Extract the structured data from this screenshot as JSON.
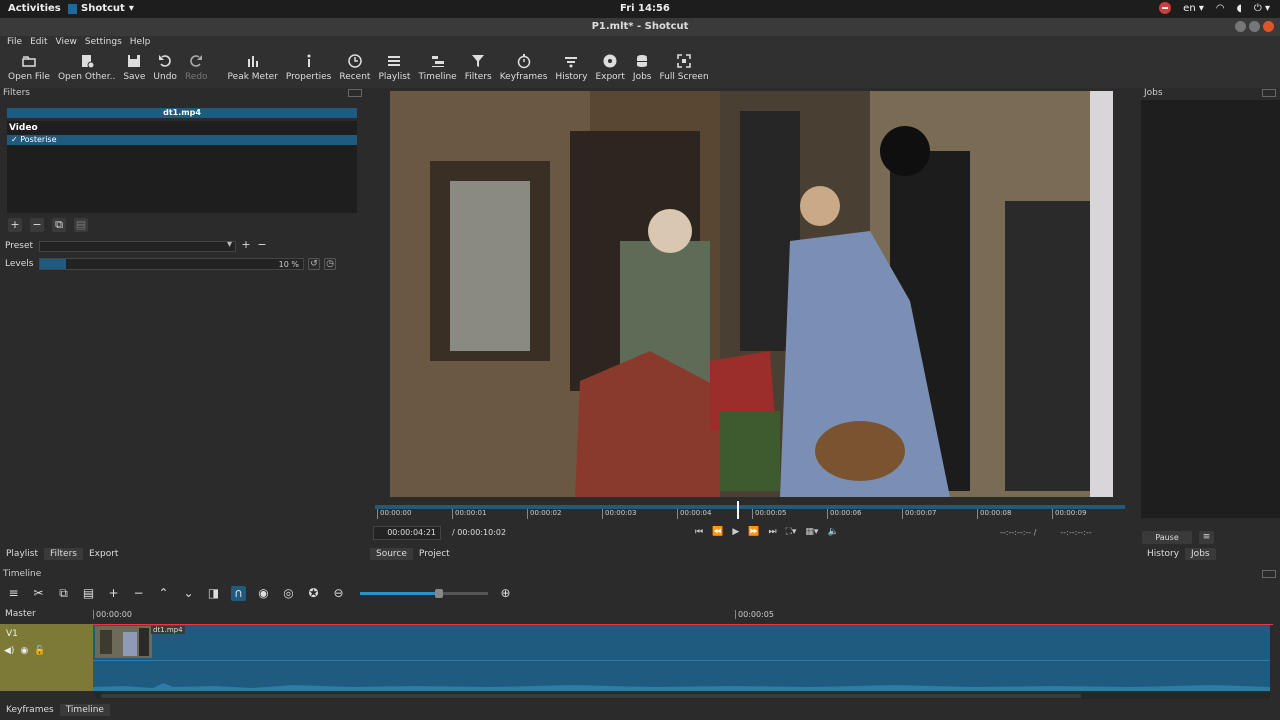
{
  "topbar": {
    "activities": "Activities",
    "app_name": "Shotcut",
    "clock": "Fri 14:56",
    "lang": "en"
  },
  "window": {
    "title": "P1.mlt* - Shotcut"
  },
  "menu": [
    "File",
    "Edit",
    "View",
    "Settings",
    "Help"
  ],
  "toolbar": [
    {
      "label": "Open File",
      "icon": "folder-open-icon"
    },
    {
      "label": "Open Other..",
      "icon": "open-other-icon"
    },
    {
      "label": "Save",
      "icon": "save-icon"
    },
    {
      "label": "Undo",
      "icon": "undo-icon"
    },
    {
      "label": "Redo",
      "icon": "redo-icon"
    },
    {
      "label": "Peak Meter",
      "icon": "peak-meter-icon"
    },
    {
      "label": "Properties",
      "icon": "info-icon"
    },
    {
      "label": "Recent",
      "icon": "clock-icon"
    },
    {
      "label": "Playlist",
      "icon": "list-icon"
    },
    {
      "label": "Timeline",
      "icon": "timeline-icon"
    },
    {
      "label": "Filters",
      "icon": "funnel-icon"
    },
    {
      "label": "Keyframes",
      "icon": "stopwatch-icon"
    },
    {
      "label": "History",
      "icon": "history-icon"
    },
    {
      "label": "Export",
      "icon": "disc-icon"
    },
    {
      "label": "Jobs",
      "icon": "database-icon"
    },
    {
      "label": "Full Screen",
      "icon": "fullscreen-icon"
    }
  ],
  "filters": {
    "panel_title": "Filters",
    "clip_name": "dt1.mp4",
    "section": "Video",
    "items": [
      {
        "check": "✓",
        "name": "Posterise"
      }
    ],
    "preset_label": "Preset",
    "levels_label": "Levels",
    "levels_value": "10 %",
    "levels_fraction": 0.1
  },
  "left_tabs": [
    "Playlist",
    "Filters",
    "Export"
  ],
  "player": {
    "ticks": [
      "00:00:00",
      "00:00:01",
      "00:00:02",
      "00:00:03",
      "00:00:04",
      "00:00:05",
      "00:00:06",
      "00:00:07",
      "00:00:08",
      "00:00:09"
    ],
    "playhead_fraction": 0.483,
    "current_time": "00:00:04:21",
    "total_time": "/ 00:00:10:02",
    "in_point": "--:--:--:-- /",
    "out_point": "--:--:--:--"
  },
  "source_tabs": [
    "Source",
    "Project"
  ],
  "jobs": {
    "panel_title": "Jobs",
    "pause_label": "Pause",
    "menu_icon": "≡"
  },
  "right_tabs": [
    "History",
    "Jobs"
  ],
  "timeline": {
    "panel_title": "Timeline",
    "master_label": "Master",
    "track_name": "V1",
    "ruler": [
      "00:00:00",
      "00:00:05"
    ],
    "clip_label": "dt1.mp4",
    "zoom_fraction": 0.62
  },
  "bottom_tabs": [
    "Keyframes",
    "Timeline"
  ]
}
